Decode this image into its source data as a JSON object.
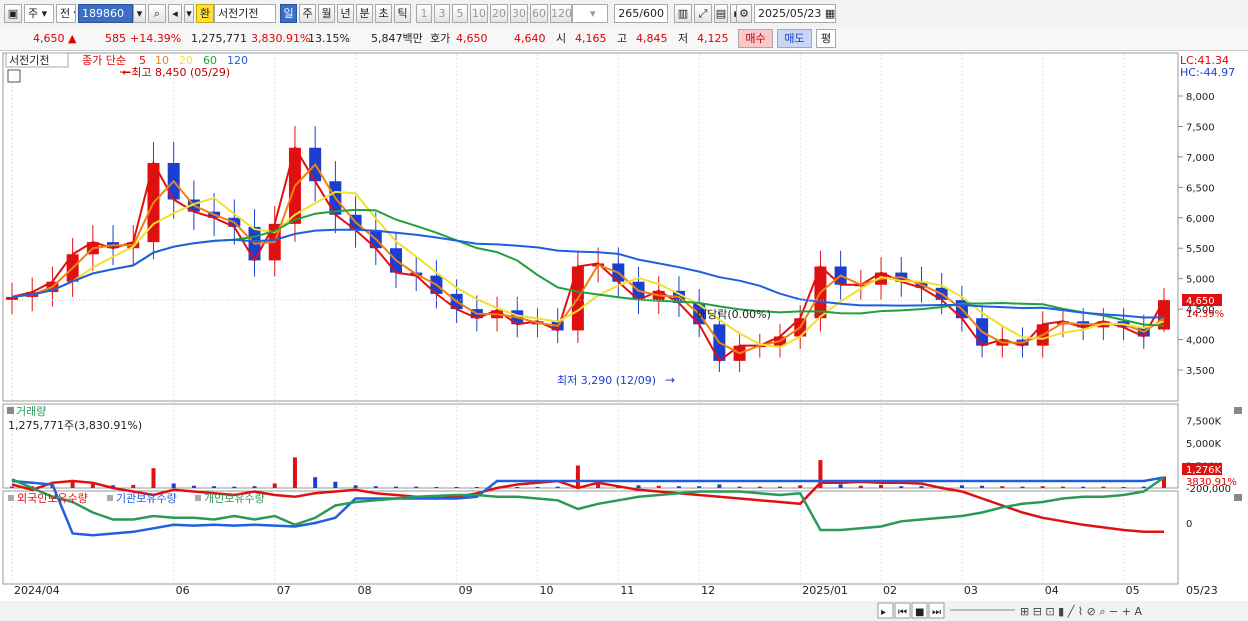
{
  "toolbar": {
    "period_label": "주",
    "prev_label": "전",
    "code": "189860",
    "hwan_label": "환",
    "stock_name": "서전기전",
    "periods": [
      "일",
      "주",
      "월",
      "년",
      "분",
      "초",
      "틱"
    ],
    "active_period": "일",
    "intervals": [
      "1",
      "3",
      "5",
      "10",
      "20",
      "30",
      "60",
      "120"
    ],
    "count": "265",
    "count_total": "/600",
    "date": "2025/05/23"
  },
  "quote": {
    "price": "4,650",
    "change": "585",
    "change_rate": "+14.39%",
    "volume": "1,275,771",
    "volume_ratio": "3,830.91%",
    "turnover_rate": "13.15%",
    "amount": "5,847백만",
    "hoga_label": "호가",
    "ask": "4,650",
    "bid": "4,640",
    "open_label": "시",
    "open": "4,165",
    "high_label": "고",
    "high": "4,845",
    "low_label": "저",
    "low": "4,125",
    "buy_label": "매수",
    "sell_label": "매도",
    "eval_label": "평"
  },
  "price_pane": {
    "name_tag": "서전기전",
    "ma_title": "종가 단순",
    "ma_periods": [
      "5",
      "10",
      "20",
      "60",
      "120"
    ],
    "ma_colors": [
      "#e01010",
      "#f08010",
      "#f0e030",
      "#20a040",
      "#2060e0"
    ],
    "lc": "LC:41.34",
    "hc": "HC:-44.97",
    "high_note": "최고 8,450 (05/29)",
    "low_note": "최저 3,290 (12/09)",
    "dividend_note": "배당락(0.00%)",
    "y_ticks": [
      "8,000",
      "7,500",
      "7,000",
      "6,500",
      "6,000",
      "5,500",
      "5,000",
      "4,500",
      "4,000",
      "3,500"
    ],
    "last_price": "4,650",
    "last_rate": "14.39%"
  },
  "volume_pane": {
    "title": "거래량",
    "value": "1,275,771주(3,830.91%)",
    "y_ticks": [
      "7,500K",
      "5,000K",
      "2,500K"
    ],
    "last_label": "1,276K",
    "last_ratio": "3830.91%"
  },
  "holder_pane": {
    "series": [
      "외국인보유수량",
      "기관보유수량",
      "개인보유수량"
    ],
    "colors": [
      "#e01010",
      "#2060e0",
      "#2a9a5a"
    ],
    "y_ticks": [
      "0",
      "-200,000"
    ]
  },
  "x_axis": [
    "2024/04",
    "06",
    "07",
    "08",
    "09",
    "10",
    "11",
    "12",
    "2025/01",
    "02",
    "03",
    "04",
    "05",
    "05/23"
  ],
  "chart_data": {
    "type": "candlestick",
    "title": "서전기전",
    "ylim": [
      3200,
      8500
    ],
    "weeks": [
      "2024/04",
      "2024/04",
      "2024/04",
      "2024/04",
      "2024/05",
      "2024/05",
      "2024/05",
      "2024/05",
      "2024/05",
      "2024/06",
      "2024/06",
      "2024/06",
      "2024/06",
      "2024/07",
      "2024/07",
      "2024/07",
      "2024/07",
      "2024/07",
      "2024/08",
      "2024/08",
      "2024/08",
      "2024/08",
      "2024/09",
      "2024/09",
      "2024/09",
      "2024/09",
      "2024/10",
      "2024/10",
      "2024/10",
      "2024/10",
      "2024/11",
      "2024/11",
      "2024/11",
      "2024/11",
      "2024/12",
      "2024/12",
      "2024/12",
      "2024/12",
      "2025/01",
      "2025/01",
      "2025/01",
      "2025/01",
      "2025/02",
      "2025/02",
      "2025/02",
      "2025/02",
      "2025/03",
      "2025/03",
      "2025/03",
      "2025/03",
      "2025/04",
      "2025/04",
      "2025/04",
      "2025/04",
      "2025/05",
      "2025/05",
      "2025/05",
      "2025/05"
    ],
    "close": [
      4700,
      4780,
      4950,
      5400,
      5600,
      5500,
      5600,
      6900,
      6300,
      6100,
      6000,
      5850,
      5300,
      5900,
      7150,
      6600,
      6050,
      5800,
      5500,
      5100,
      5050,
      4750,
      4500,
      4350,
      4480,
      4250,
      4300,
      4150,
      5200,
      5250,
      4950,
      4650,
      4800,
      4600,
      4250,
      3650,
      3900,
      3900,
      4050,
      4350,
      5200,
      4900,
      4900,
      5100,
      4950,
      4850,
      4650,
      4350,
      3900,
      4000,
      3900,
      4250,
      4300,
      4200,
      4300,
      4200,
      4050,
      4650
    ],
    "volume_k": [
      150,
      200,
      350,
      900,
      450,
      300,
      350,
      2200,
      500,
      250,
      200,
      150,
      200,
      500,
      3400,
      1200,
      700,
      300,
      200,
      150,
      150,
      100,
      100,
      100,
      100,
      100,
      100,
      150,
      2500,
      600,
      300,
      300,
      250,
      200,
      200,
      400,
      150,
      150,
      150,
      300,
      3100,
      400,
      250,
      350,
      200,
      200,
      150,
      300,
      250,
      200,
      150,
      200,
      150,
      150,
      150,
      100,
      150,
      1276
    ],
    "holders": {
      "foreign": [
        -220000,
        -190000,
        -230000,
        -240000,
        -230000,
        -200000,
        -180000,
        -160000,
        -190000,
        -180000,
        -170000,
        -160000,
        -180000,
        -160000,
        -150000,
        -170000,
        -180000,
        -190000,
        -170000,
        -160000,
        -150000,
        -140000,
        -150000,
        -170000,
        -200000,
        -220000,
        -230000,
        -240000,
        -200000,
        -230000,
        -210000,
        -190000,
        -180000,
        -170000,
        -160000,
        -150000,
        -140000,
        -130000,
        -120000,
        -110000,
        -230000,
        -230000,
        -235000,
        -230000,
        -230000,
        -225000,
        -200000,
        -180000,
        -140000,
        -100000,
        -60000,
        -30000,
        -10000,
        10000,
        25000,
        40000,
        50000,
        50000
      ],
      "institution": [
        -240000,
        -230000,
        -220000,
        60000,
        70000,
        60000,
        50000,
        30000,
        10000,
        15000,
        10000,
        15000,
        10000,
        15000,
        20000,
        0,
        -30000,
        -140000,
        -140000,
        -140000,
        -140000,
        -140000,
        -140000,
        -150000,
        -240000,
        -240000,
        -240000,
        -240000,
        -240000,
        -240000,
        -240000,
        -240000,
        -240000,
        -240000,
        -240000,
        -240000,
        -240000,
        -240000,
        -240000,
        -240000,
        -240000,
        -240000,
        -240000,
        -240000,
        -240000,
        -240000,
        -240000,
        -240000,
        -240000,
        -240000,
        -240000,
        -240000,
        -240000,
        -240000,
        -240000,
        -240000,
        -240000,
        -260000
      ],
      "individual": [
        -250000,
        -200000,
        -150000,
        -120000,
        -60000,
        -20000,
        -20000,
        -40000,
        -30000,
        -30000,
        -20000,
        -40000,
        -20000,
        -40000,
        10000,
        -30000,
        -100000,
        -120000,
        -130000,
        -140000,
        -150000,
        -155000,
        -160000,
        -160000,
        -150000,
        -150000,
        -140000,
        -130000,
        -80000,
        -110000,
        -130000,
        -150000,
        -160000,
        -170000,
        -180000,
        -180000,
        -180000,
        -170000,
        -160000,
        -170000,
        40000,
        40000,
        30000,
        20000,
        -10000,
        -20000,
        -30000,
        -40000,
        -60000,
        -90000,
        -110000,
        -120000,
        -140000,
        -150000,
        -150000,
        -160000,
        -180000,
        -260000
      ]
    }
  }
}
